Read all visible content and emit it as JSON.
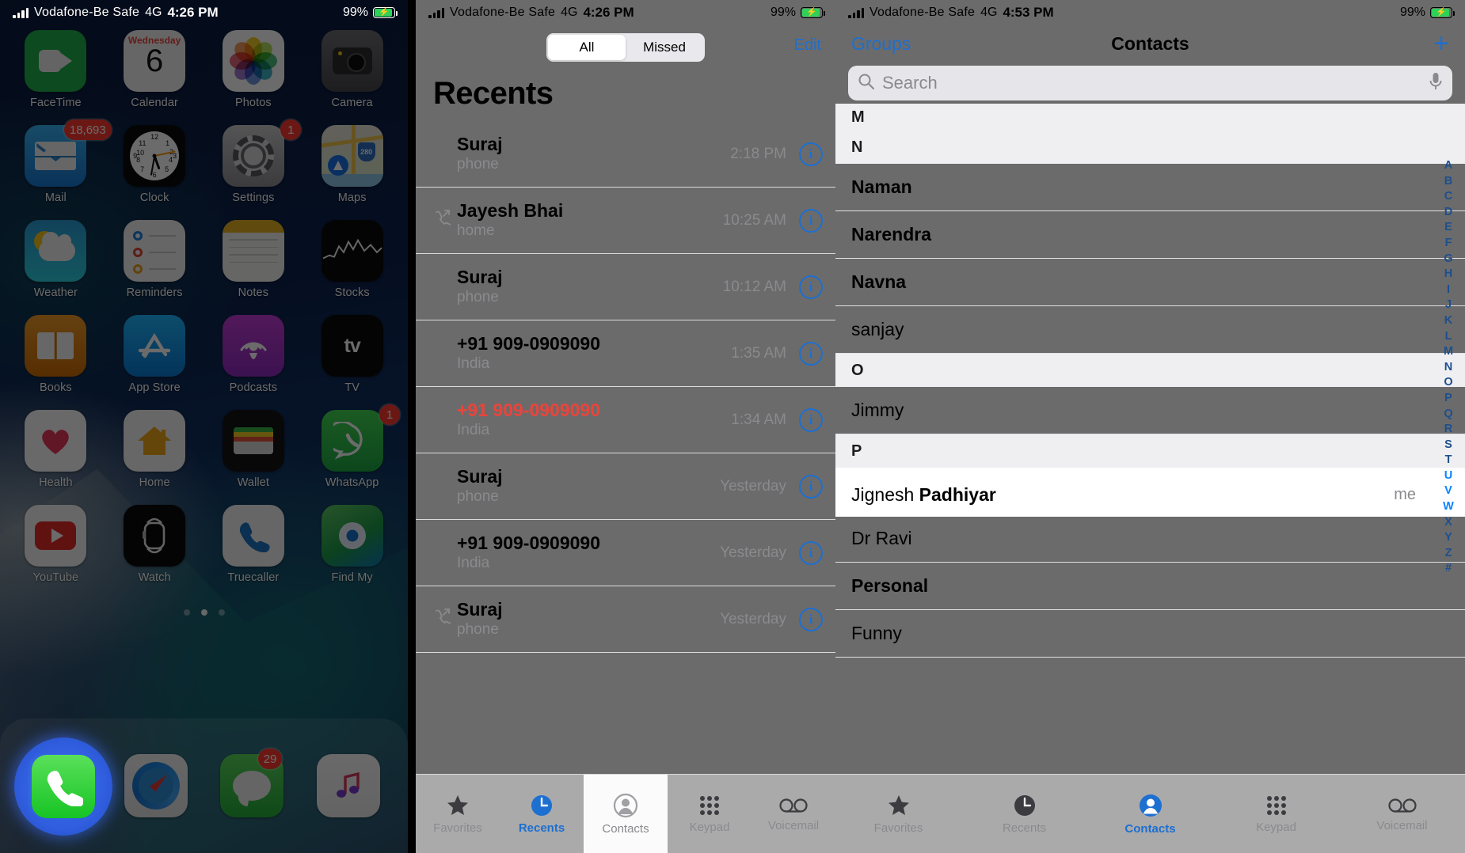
{
  "status_bar": {
    "carrier": "Vodafone-Be Safe",
    "network": "4G",
    "time_left": "4:26 PM",
    "time_right": "4:53 PM",
    "battery_pct": "99%",
    "signal_icon": "signal-bars-icon",
    "battery_icon": "battery-charging-icon"
  },
  "home_screen": {
    "apps": [
      {
        "label": "FaceTime",
        "icon": "facetime-icon",
        "badge": ""
      },
      {
        "label": "Calendar",
        "icon": "calendar-icon",
        "badge": "",
        "day": "Wednesday",
        "date": "6"
      },
      {
        "label": "Photos",
        "icon": "photos-icon",
        "badge": ""
      },
      {
        "label": "Camera",
        "icon": "camera-icon",
        "badge": ""
      },
      {
        "label": "Mail",
        "icon": "mail-icon",
        "badge": "18,693"
      },
      {
        "label": "Clock",
        "icon": "clock-icon",
        "badge": ""
      },
      {
        "label": "Settings",
        "icon": "settings-gear-icon",
        "badge": "1"
      },
      {
        "label": "Maps",
        "icon": "maps-icon",
        "badge": ""
      },
      {
        "label": "Weather",
        "icon": "weather-icon",
        "badge": ""
      },
      {
        "label": "Reminders",
        "icon": "reminders-icon",
        "badge": ""
      },
      {
        "label": "Notes",
        "icon": "notes-icon",
        "badge": ""
      },
      {
        "label": "Stocks",
        "icon": "stocks-icon",
        "badge": ""
      },
      {
        "label": "Books",
        "icon": "books-icon",
        "badge": ""
      },
      {
        "label": "App Store",
        "icon": "app-store-icon",
        "badge": ""
      },
      {
        "label": "Podcasts",
        "icon": "podcasts-icon",
        "badge": ""
      },
      {
        "label": "TV",
        "icon": "apple-tv-icon",
        "badge": ""
      },
      {
        "label": "Health",
        "icon": "health-heart-icon",
        "badge": ""
      },
      {
        "label": "Home",
        "icon": "home-house-icon",
        "badge": ""
      },
      {
        "label": "Wallet",
        "icon": "wallet-icon",
        "badge": ""
      },
      {
        "label": "WhatsApp",
        "icon": "whatsapp-icon",
        "badge": "1"
      },
      {
        "label": "YouTube",
        "icon": "youtube-icon",
        "badge": ""
      },
      {
        "label": "Watch",
        "icon": "apple-watch-icon",
        "badge": ""
      },
      {
        "label": "Truecaller",
        "icon": "truecaller-icon",
        "badge": ""
      },
      {
        "label": "Find My",
        "icon": "find-my-icon",
        "badge": ""
      }
    ],
    "page_dots": 3,
    "active_dot": 1,
    "dock": [
      {
        "label": "Phone",
        "icon": "phone-icon",
        "badge": "",
        "highlighted": true
      },
      {
        "label": "Safari",
        "icon": "safari-compass-icon",
        "badge": ""
      },
      {
        "label": "Messages",
        "icon": "messages-bubble-icon",
        "badge": "29"
      },
      {
        "label": "Music",
        "icon": "music-note-icon",
        "badge": ""
      }
    ]
  },
  "recents": {
    "segment": {
      "options": [
        "All",
        "Missed"
      ],
      "selected": "All"
    },
    "edit_label": "Edit",
    "title": "Recents",
    "calls": [
      {
        "name": "Suraj",
        "sub": "phone",
        "time": "2:18 PM",
        "missed": false,
        "outgoing": false
      },
      {
        "name": "Jayesh Bhai",
        "sub": "home",
        "time": "10:25 AM",
        "missed": false,
        "outgoing": true
      },
      {
        "name": "Suraj",
        "sub": "phone",
        "time": "10:12 AM",
        "missed": false,
        "outgoing": false
      },
      {
        "name": "+91 909-0909090",
        "sub": "India",
        "time": "1:35 AM",
        "missed": false,
        "outgoing": false
      },
      {
        "name": "+91 909-0909090",
        "sub": "India",
        "time": "1:34 AM",
        "missed": true,
        "outgoing": false
      },
      {
        "name": "Suraj",
        "sub": "phone",
        "time": "Yesterday",
        "missed": false,
        "outgoing": false
      },
      {
        "name": "+91 909-0909090",
        "sub": "India",
        "time": "Yesterday",
        "missed": false,
        "outgoing": false
      },
      {
        "name": "Suraj",
        "sub": "phone",
        "time": "Yesterday",
        "missed": false,
        "outgoing": true
      }
    ],
    "info_glyph": "i"
  },
  "tabbar": {
    "tabs": [
      {
        "label": "Favorites",
        "icon": "star-icon"
      },
      {
        "label": "Recents",
        "icon": "clock-icon"
      },
      {
        "label": "Contacts",
        "icon": "person-circle-icon"
      },
      {
        "label": "Keypad",
        "icon": "keypad-dots-icon"
      },
      {
        "label": "Voicemail",
        "icon": "voicemail-icon"
      }
    ],
    "selected_panel2": "Recents",
    "highlighted_panel2": "Contacts",
    "selected_panel3": "Contacts"
  },
  "contacts": {
    "groups_label": "Groups",
    "title": "Contacts",
    "add_icon": "plus-icon",
    "search": {
      "placeholder": "Search",
      "search_icon": "search-icon",
      "mic_icon": "microphone-icon"
    },
    "rows": [
      {
        "type": "section",
        "text": "M"
      },
      {
        "type": "section",
        "text": "N"
      },
      {
        "type": "contact",
        "first": "Naman",
        "last": "",
        "bold_first": true
      },
      {
        "type": "contact",
        "first": "Narendra",
        "last": "",
        "bold_first": true
      },
      {
        "type": "contact",
        "first": "Navna",
        "last": "",
        "bold_first": true
      },
      {
        "type": "contact",
        "first": "sanjay",
        "last": "",
        "bold_first": false
      },
      {
        "type": "section",
        "text": "O"
      },
      {
        "type": "contact",
        "first": "Jimmy",
        "last": "",
        "bold_first": false
      },
      {
        "type": "section",
        "text": "P"
      },
      {
        "type": "contact",
        "first": "Jignesh",
        "last": "Padhiyar",
        "bold_first": false,
        "me": "me",
        "highlighted": true
      },
      {
        "type": "contact",
        "first": "Dr Ravi",
        "last": "",
        "bold_first": false
      },
      {
        "type": "contact",
        "first": "Personal",
        "last": "",
        "bold_first": true
      },
      {
        "type": "contact",
        "first": "Funny",
        "last": "",
        "bold_first": false
      }
    ],
    "index": [
      "A",
      "B",
      "C",
      "D",
      "E",
      "F",
      "G",
      "H",
      "I",
      "J",
      "K",
      "L",
      "M",
      "N",
      "O",
      "P",
      "Q",
      "R",
      "S",
      "T",
      "U",
      "V",
      "W",
      "X",
      "Y",
      "Z",
      "#"
    ]
  }
}
